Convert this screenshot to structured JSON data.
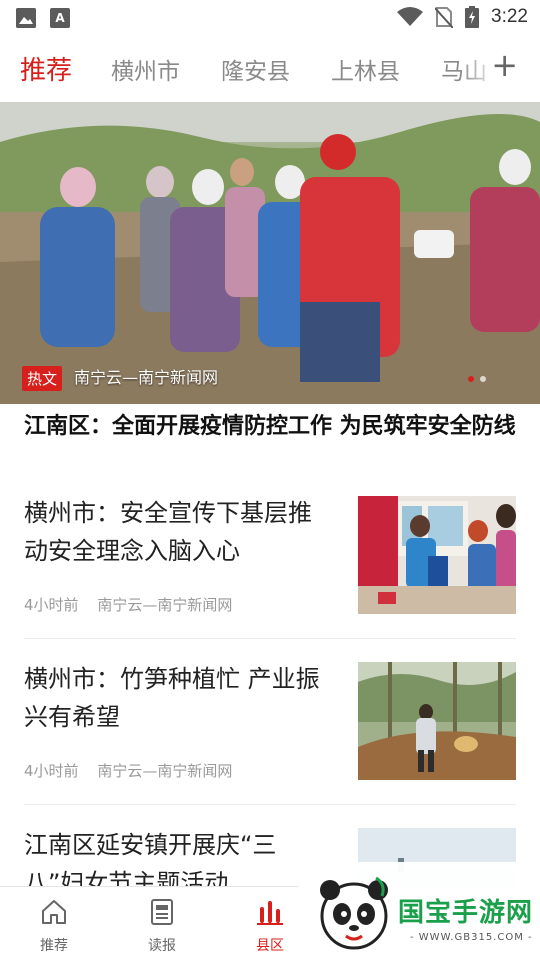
{
  "status_bar": {
    "time": "3:22",
    "left_icons": [
      "image-icon",
      "a-icon"
    ],
    "right_icons": [
      "wifi-icon",
      "no-sim-icon",
      "battery-charging-icon"
    ]
  },
  "tabs": {
    "items": [
      "推荐",
      "横州市",
      "隆安县",
      "上林县",
      "马山"
    ],
    "active_index": 0,
    "add_icon": "plus-icon"
  },
  "hero": {
    "tag": "热文",
    "source": "南宁云—南宁新闻网",
    "dots": 2,
    "active_dot": 0,
    "headline": "江南区：全面开展疫情防控工作 为民筑牢安全防线"
  },
  "news": [
    {
      "title": "横州市：安全宣传下基层推动安全理念入脑入心",
      "time": "4小时前",
      "source": "南宁云—南宁新闻网"
    },
    {
      "title": "横州市：竹笋种植忙 产业振兴有希望",
      "time": "4小时前",
      "source": "南宁云—南宁新闻网"
    },
    {
      "title": "江南区延安镇开展庆“三八”妇女节主题活动"
    }
  ],
  "bottom_nav": {
    "items": [
      {
        "label": "推荐",
        "icon": "home-icon"
      },
      {
        "label": "读报",
        "icon": "newspaper-icon"
      },
      {
        "label": "县区",
        "icon": "county-bars-icon"
      }
    ],
    "active_index": 2
  },
  "watermark": {
    "text": "国宝手游网",
    "url": "- WWW.GB315.COM -"
  },
  "colors": {
    "accent": "#d7201b",
    "inactive_tab": "#8a8a8a",
    "meta": "#9a9a9a"
  }
}
